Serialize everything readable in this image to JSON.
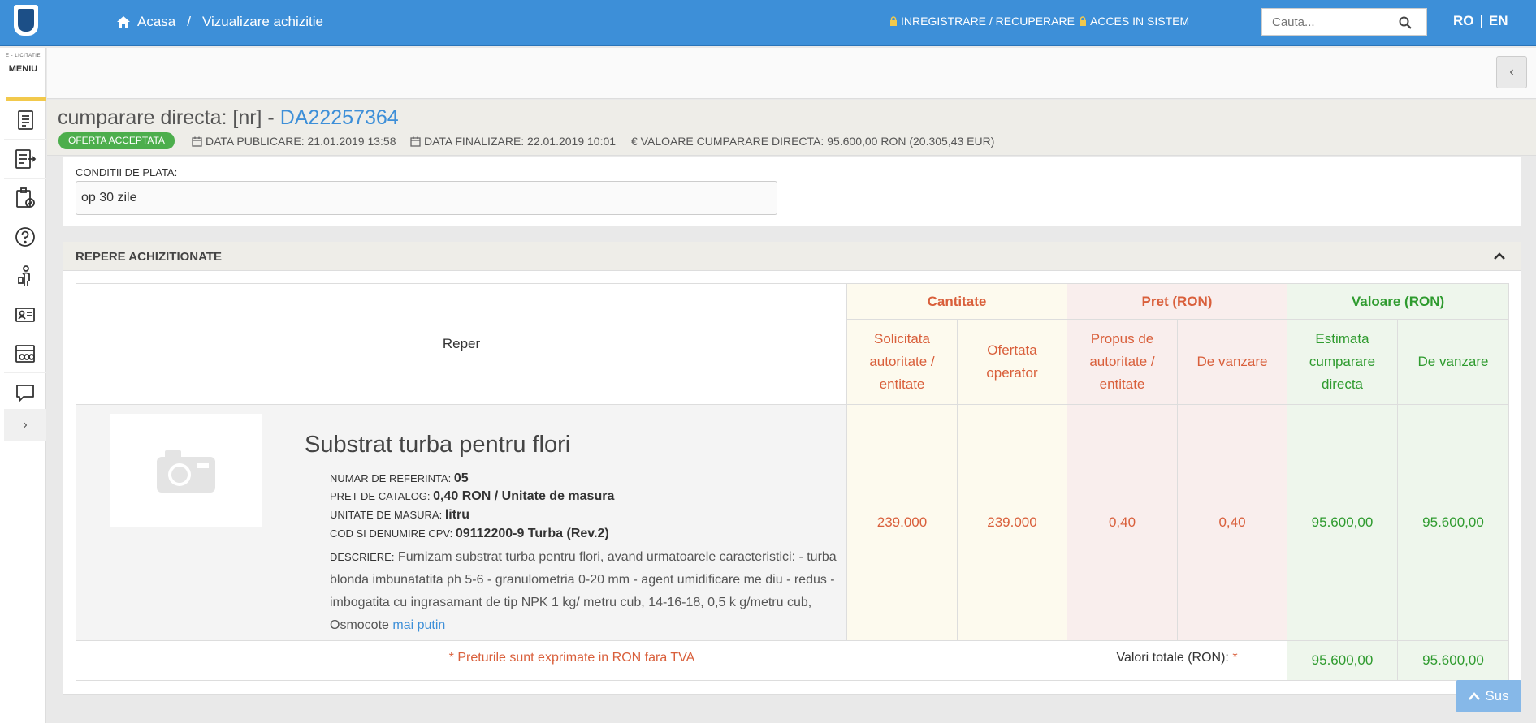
{
  "header": {
    "breadcrumb": {
      "home": "Acasa",
      "separator": "/",
      "current": "Vizualizare achizitie"
    },
    "register_link": "INREGISTRARE / RECUPERARE",
    "login_link": "ACCES IN SISTEM",
    "search": {
      "placeholder": "Cauta..."
    },
    "lang": {
      "ro": "RO",
      "sep": "|",
      "en": "EN"
    }
  },
  "sidebar": {
    "small_label": "E - LICITATIE",
    "menu_label": "MENIU",
    "items": [
      {
        "icon": "document-list-icon"
      },
      {
        "icon": "list-export-icon"
      },
      {
        "icon": "clipboard-check-icon"
      },
      {
        "icon": "help-circle-icon"
      },
      {
        "icon": "person-handshake-icon"
      },
      {
        "icon": "id-card-icon"
      },
      {
        "icon": "catalog-icon"
      },
      {
        "icon": "chat-bubble-icon"
      }
    ],
    "expand": "›"
  },
  "collapse_button": "‹",
  "acquisition": {
    "title_prefix": "cumparare directa: [nr] - ",
    "code": "DA22257364",
    "status": "OFERTA ACCEPTATA",
    "publish": "DATA PUBLICARE: 21.01.2019 13:58",
    "finalize": "DATA FINALIZARE: 22.01.2019 10:01",
    "value": "€ VALOARE CUMPARARE DIRECTA: 95.600,00  RON (20.305,43  EUR)"
  },
  "payment": {
    "label": "CONDITII DE PLATA:",
    "value": "op 30 zile"
  },
  "items": {
    "title": "REPERE ACHIZITIONATE",
    "headers": {
      "reper": "Reper",
      "cantitate": "Cantitate",
      "pret": "Pret (RON)",
      "valoare": "Valoare (RON)",
      "solicitata": "Solicitata autoritate / entitate",
      "ofertata": "Ofertata operator",
      "propus": "Propus de autoritate / entitate",
      "de_vanzare_pret": "De vanzare",
      "estimata": "Estimata cumparare directa",
      "de_vanzare_val": "De vanzare"
    },
    "rows": [
      {
        "name": "Substrat turba pentru flori",
        "ref_label": "NUMAR DE REFERINTA:",
        "ref": "05",
        "catalog_label": "PRET DE CATALOG:",
        "catalog": "0,40  RON / Unitate de masura",
        "unit_label": "UNITATE DE MASURA:",
        "unit": "litru",
        "cpv_label": "COD SI DENUMIRE CPV:",
        "cpv": "09112200-9 Turba (Rev.2)",
        "desc_label": "DESCRIERE:",
        "desc": "Furnizam substrat turba pentru flori, avand urmatoarele caracteristici: - turba blonda imbunatatita ph 5-6 - granulometria 0-20 mm - agent umidificare me diu - redus - imbogatita cu ingrasamant de tip NPK 1 kg/ metru cub, 14-16-18, 0,5 k g/metru cub, Osmocote",
        "more": "mai putin",
        "qty_requested": "239.000",
        "qty_offered": "239.000",
        "price_proposed": "0,40",
        "price_sale": "0,40",
        "val_estimated": "95.600,00",
        "val_sale": "95.600,00"
      }
    ],
    "note": "* Preturile sunt exprimate in RON fara TVA",
    "totals_label": "Valori totale (RON):",
    "totals_star": "*",
    "total_estimated": "95.600,00",
    "total_sale": "95.600,00"
  },
  "back_to_top": "Sus",
  "colors": {
    "header_blue": "#3d8fd8",
    "status_green": "#4cae4c",
    "qty_text": "#d95f3b",
    "value_text": "#2f9b2f"
  }
}
